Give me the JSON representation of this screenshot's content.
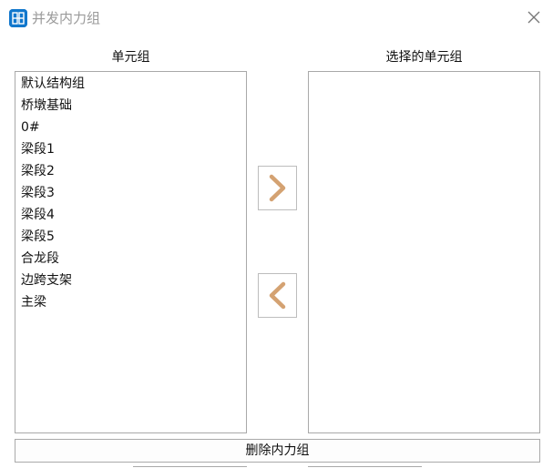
{
  "window": {
    "title": "并发内力组",
    "app_icon": "app-logo-icon",
    "close_icon": "close-icon",
    "accent_color": "#1177cc"
  },
  "left_panel": {
    "header": "单元组",
    "items": [
      "默认结构组",
      "桥墩基础",
      "0#",
      "梁段1",
      "梁段2",
      "梁段3",
      "梁段4",
      "梁段5",
      "合龙段",
      "边跨支架",
      "主梁"
    ]
  },
  "right_panel": {
    "header": "选择的单元组",
    "items": []
  },
  "transfer_buttons": {
    "add_icon": "chevron-right-icon",
    "remove_icon": "chevron-left-icon",
    "arrow_color": "#d4a272"
  },
  "actions": {
    "delete_label": "删除内力组"
  }
}
